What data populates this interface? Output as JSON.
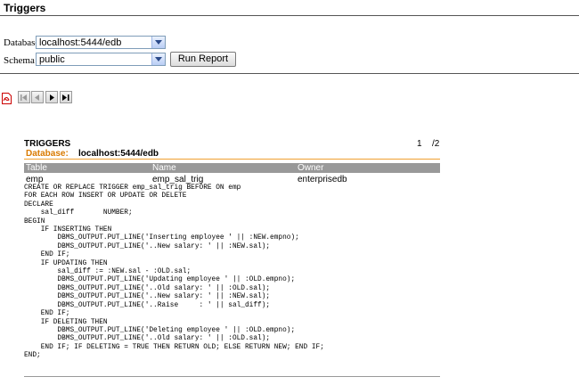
{
  "page_title": "Triggers",
  "form": {
    "database_label": "Database",
    "database_value": "localhost:5444/edb",
    "schema_label": "Schema",
    "schema_value": "public",
    "run_button": "Run Report"
  },
  "report": {
    "title": "TRIGGERS",
    "page_current": "1",
    "page_total": "/2",
    "database_label": "Database:",
    "database_value": "localhost:5444/edb",
    "columns": [
      "Table",
      "Name",
      "Owner"
    ],
    "row": [
      "emp",
      "emp_sal_trig",
      "enterprisedb"
    ],
    "source": "CREATE OR REPLACE TRIGGER emp_sal_trig BEFORE ON emp\nFOR EACH ROW INSERT OR UPDATE OR DELETE\nDECLARE\n    sal_diff       NUMBER;\nBEGIN\n    IF INSERTING THEN\n        DBMS_OUTPUT.PUT_LINE('Inserting employee ' || :NEW.empno);\n        DBMS_OUTPUT.PUT_LINE('..New salary: ' || :NEW.sal);\n    END IF;\n    IF UPDATING THEN\n        sal_diff := :NEW.sal - :OLD.sal;\n        DBMS_OUTPUT.PUT_LINE('Updating employee ' || :OLD.empno);\n        DBMS_OUTPUT.PUT_LINE('..Old salary: ' || :OLD.sal);\n        DBMS_OUTPUT.PUT_LINE('..New salary: ' || :NEW.sal);\n        DBMS_OUTPUT.PUT_LINE('..Raise     : ' || sal_diff);\n    END IF;\n    IF DELETING THEN\n        DBMS_OUTPUT.PUT_LINE('Deleting employee ' || :OLD.empno);\n        DBMS_OUTPUT.PUT_LINE('..Old salary: ' || :OLD.sal);\n    END IF; IF DELETING = TRUE THEN RETURN OLD; ELSE RETURN NEW; END IF;\nEND;"
  },
  "toolbar": {
    "icons": [
      "pdf-export-icon",
      "first-page-icon",
      "previous-page-icon",
      "next-page-icon",
      "last-page-icon"
    ]
  },
  "colors": {
    "accent_orange": "#d97a00",
    "header_gray": "#999999",
    "combo_border": "#7f9db9"
  }
}
